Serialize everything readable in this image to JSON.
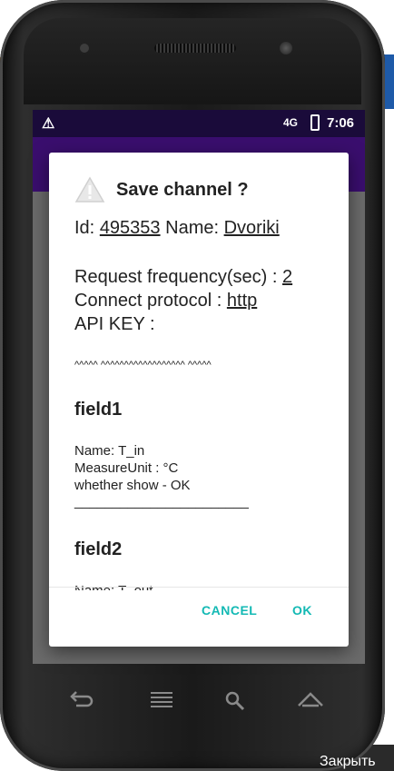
{
  "statusbar": {
    "warning_glyph": "⚠",
    "network": "4G",
    "time": "7:06"
  },
  "dialog": {
    "title": "Save channel ?",
    "id_label": "Id:",
    "id_value": "495353",
    "name_label": "Name:",
    "name_value": "Dvoriki",
    "freq_label": "Request frequency(sec) :",
    "freq_value": "2",
    "protocol_label": "Connect protocol :",
    "protocol_value": "http",
    "apikey_label": "API KEY :",
    "apikey_value": "^^^^^ ^^^^^^^^^^^^^^^^^^ ^^^^^",
    "fields": [
      {
        "title": "field1",
        "name_line": "Name: T_in",
        "unit_line": "MeasureUnit : °C",
        "show_line": "whether show - OK",
        "separator": "_______________________"
      },
      {
        "title": "field2",
        "name_line": "Name: T_out"
      }
    ],
    "cancel_label": "CANCEL",
    "ok_label": "OK"
  },
  "background": {
    "close_text": "Закрыть"
  },
  "colors": {
    "accent": "#13b9b4",
    "appbar": "#3a0e6e",
    "statusbar": "#1a0b3a"
  },
  "icons": {
    "nav_back": "back-icon",
    "nav_home": "home-icon",
    "nav_menu": "menu-icon",
    "nav_search": "search-icon"
  }
}
